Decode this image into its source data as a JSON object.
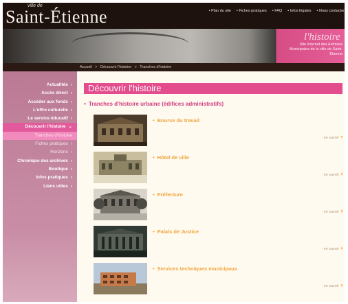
{
  "header": {
    "logo": "Saint-Étienne",
    "logo_sub": "ville de",
    "nav": [
      "• Plan du site",
      "• Fiches pratiques",
      "• FAQ",
      "• Infos légales",
      "• Nous contacter"
    ]
  },
  "banner": {
    "title": "l'histoire",
    "subtitle": "Site Internet des Archives Municipales de la ville de Saint-Étienne"
  },
  "breadcrumb": [
    "Accueil",
    ">",
    "Découvrir l'histoire",
    ">",
    "Tranches d'histoire"
  ],
  "sidebar": {
    "items": [
      {
        "label": "Actualités",
        "arrow": "›",
        "state": "normal"
      },
      {
        "label": "Accès direct",
        "arrow": "›",
        "state": "normal"
      },
      {
        "label": "Accéder aux fonds",
        "arrow": "›",
        "state": "normal"
      },
      {
        "label": "L'offre culturelle",
        "arrow": "›",
        "state": "normal"
      },
      {
        "label": "Le service éducatif",
        "arrow": "›",
        "state": "normal"
      },
      {
        "label": "Découvrir l'histoire",
        "arrow": "⌄",
        "state": "active"
      },
      {
        "label": "Tranches d'histoire",
        "arrow": "",
        "state": "sub1"
      },
      {
        "label": "Fiches pratiques",
        "arrow": "›",
        "state": "sub"
      },
      {
        "label": "Horizons",
        "arrow": "›",
        "state": "sub"
      },
      {
        "label": "Chronique des archives",
        "arrow": "›",
        "state": "normal"
      },
      {
        "label": "Boutique",
        "arrow": "›",
        "state": "normal"
      },
      {
        "label": "Infos pratiques",
        "arrow": "›",
        "state": "normal"
      },
      {
        "label": "Liens utiles",
        "arrow": "›",
        "state": "normal"
      }
    ]
  },
  "main": {
    "title": "Découvrir l'histoire",
    "section": "Tranches d'histoire urbaine (édifices administratifs)",
    "bullet": "•",
    "more_label": "en savoir",
    "more_plus": "+",
    "items": [
      {
        "title": "Bourse du travail"
      },
      {
        "title": "Hôtel de ville"
      },
      {
        "title": "Préfecture"
      },
      {
        "title": "Palais de Justice"
      },
      {
        "title": "Services techniques municipaux"
      }
    ]
  },
  "colors": {
    "accent": "#e34d8d",
    "item_title": "#f0a43a",
    "sidebar": "#c98ea6",
    "header": "#1e120e"
  }
}
